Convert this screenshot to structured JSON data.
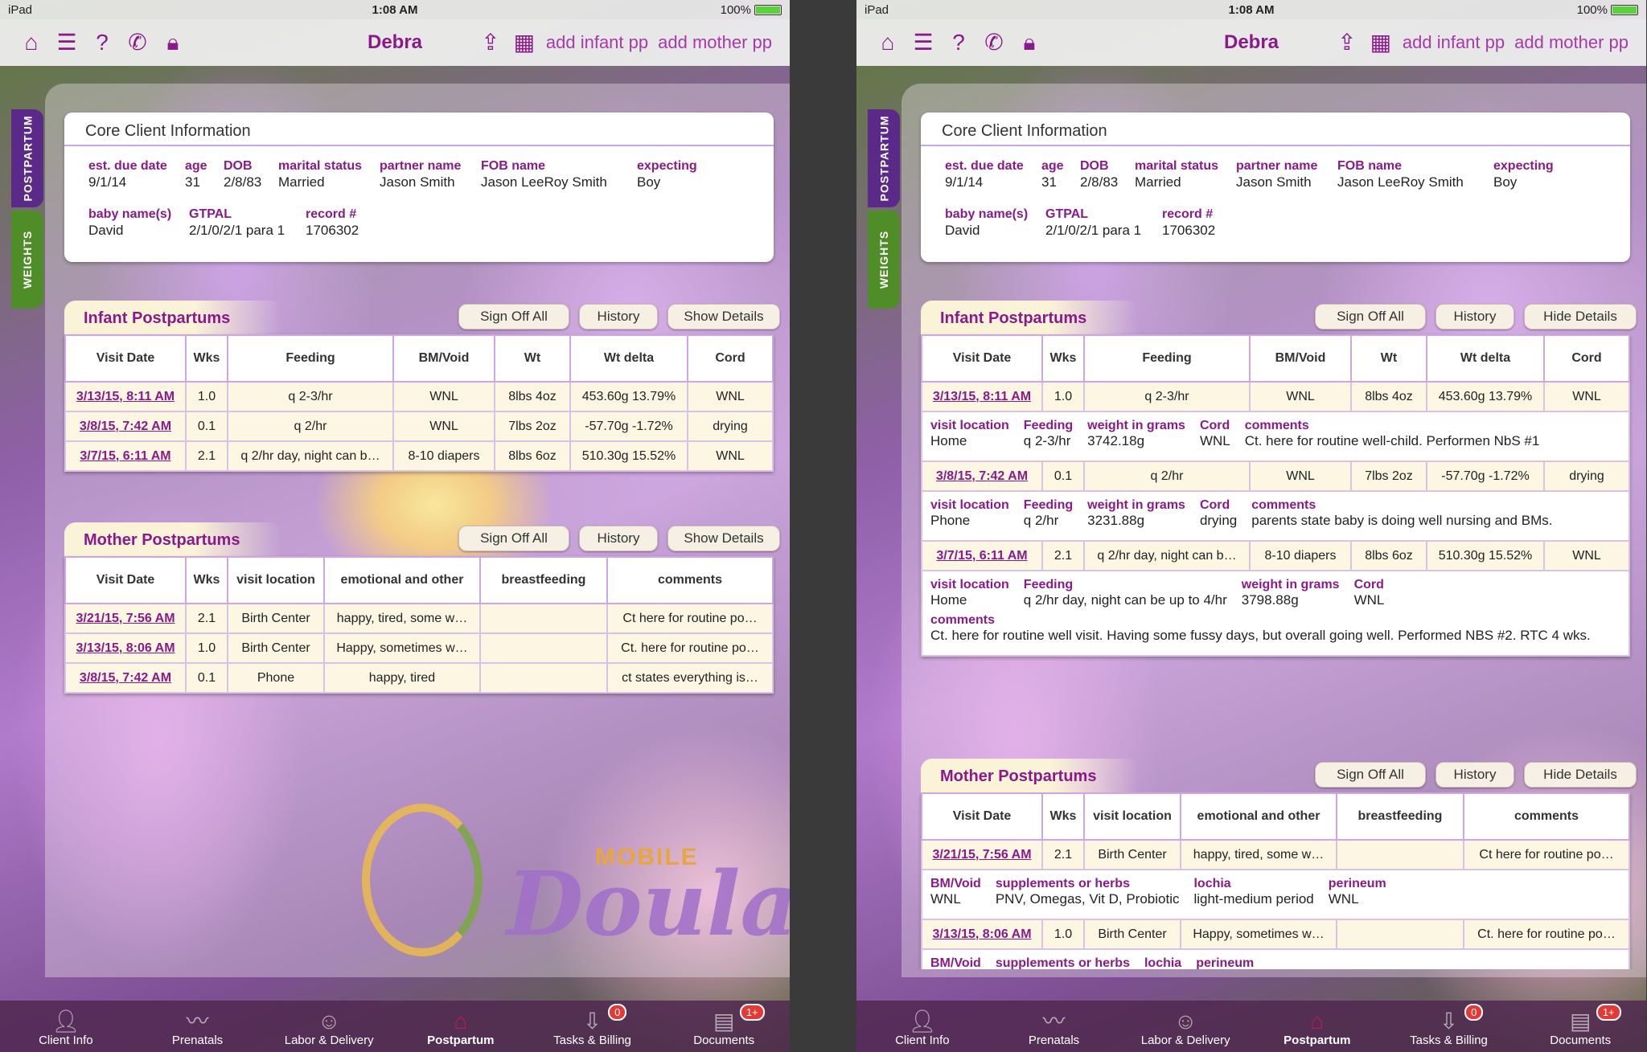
{
  "status": {
    "device": "iPad",
    "time": "1:08 AM",
    "battery": "100%"
  },
  "nav": {
    "title": "Debra",
    "add_infant": "add infant pp",
    "add_mother": "add mother pp"
  },
  "sidetabs": {
    "postpartum": "POSTPARTUM",
    "weights": "WEIGHTS"
  },
  "core": {
    "title": "Core Client Information",
    "fields": [
      {
        "label": "est. due date",
        "value": "9/1/14"
      },
      {
        "label": "age",
        "value": "31"
      },
      {
        "label": "DOB",
        "value": "2/8/83"
      },
      {
        "label": "marital status",
        "value": "Married"
      },
      {
        "label": "partner name",
        "value": "Jason Smith"
      },
      {
        "label": "FOB name",
        "value": "Jason LeeRoy Smith"
      },
      {
        "label": "expecting",
        "value": "Boy"
      },
      {
        "label": "baby name(s)",
        "value": "David"
      },
      {
        "label": "GTPAL",
        "value": "2/1/0/2/1 para 1"
      },
      {
        "label": "record #",
        "value": "1706302"
      }
    ]
  },
  "buttons": {
    "sign_off": "Sign Off All",
    "history": "History",
    "show_details": "Show Details",
    "hide_details": "Hide Details"
  },
  "infant": {
    "title": "Infant Postpartums",
    "headers": [
      "Visit Date",
      "Wks",
      "Feeding",
      "BM/Void",
      "Wt",
      "Wt delta",
      "Cord"
    ],
    "rows": [
      [
        "3/13/15, 8:11 AM",
        "1.0",
        "q 2-3/hr",
        "WNL",
        "8lbs 4oz",
        "453.60g 13.79%",
        "WNL"
      ],
      [
        "3/8/15, 7:42 AM",
        "0.1",
        "q 2/hr",
        "WNL",
        "7lbs 2oz",
        "-57.70g -1.72%",
        "drying"
      ],
      [
        "3/7/15, 6:11 AM",
        "2.1",
        "q 2/hr day, night can b…",
        "8-10 diapers",
        "8lbs 6oz",
        "510.30g 15.52%",
        "WNL"
      ]
    ],
    "details": [
      {
        "visit_location": "Home",
        "feeding": "q 2-3/hr",
        "weight_grams": "3742.18g",
        "cord": "WNL",
        "comments": "Ct. here for routine well-child.  Performen NbS #1"
      },
      {
        "visit_location": "Phone",
        "feeding": "q 2/hr",
        "weight_grams": "3231.88g",
        "cord": "drying",
        "comments": "parents state baby is doing well nursing and BMs."
      },
      {
        "visit_location": "Home",
        "feeding": "q 2/hr day, night can be up to 4/hr",
        "weight_grams": "3798.88g",
        "cord": "WNL",
        "comments": "Ct. here for routine well visit.   Having some fussy days, but overall going well.  Performed NBS #2.  RTC 4 wks."
      }
    ],
    "detail_labels": {
      "visit_location": "visit location",
      "feeding": "Feeding",
      "weight_grams": "weight in grams",
      "cord": "Cord",
      "comments": "comments"
    }
  },
  "mother": {
    "title": "Mother Postpartums",
    "headers": [
      "Visit Date",
      "Wks",
      "visit location",
      "emotional and other",
      "breastfeeding",
      "comments"
    ],
    "rows": [
      [
        "3/21/15, 7:56 AM",
        "2.1",
        "Birth Center",
        "happy, tired, some w…",
        "",
        "Ct here for routine po…"
      ],
      [
        "3/13/15, 8:06 AM",
        "1.0",
        "Birth Center",
        "Happy, sometimes w…",
        "",
        "Ct. here for routine po…"
      ],
      [
        "3/8/15, 7:42 AM",
        "0.1",
        "Phone",
        "happy, tired",
        "",
        "ct states everything is…"
      ]
    ],
    "details": [
      {
        "bm_void": "WNL",
        "supplements": "PNV, Omegas, Vit D, Probiotic",
        "lochia": "light-medium period",
        "perineum": "WNL"
      }
    ],
    "detail_labels": {
      "bm_void": "BM/Void",
      "supplements": "supplements or herbs",
      "lochia": "lochia",
      "perineum": "perineum"
    }
  },
  "tabs": [
    {
      "label": "Client Info"
    },
    {
      "label": "Prenatals"
    },
    {
      "label": "Labor & Delivery"
    },
    {
      "label": "Postpartum"
    },
    {
      "label": "Tasks & Billing",
      "badge": "0"
    },
    {
      "label": "Documents",
      "badge": "1+"
    }
  ],
  "logo": {
    "mobile": "MOBILE",
    "doula": "Doula"
  }
}
